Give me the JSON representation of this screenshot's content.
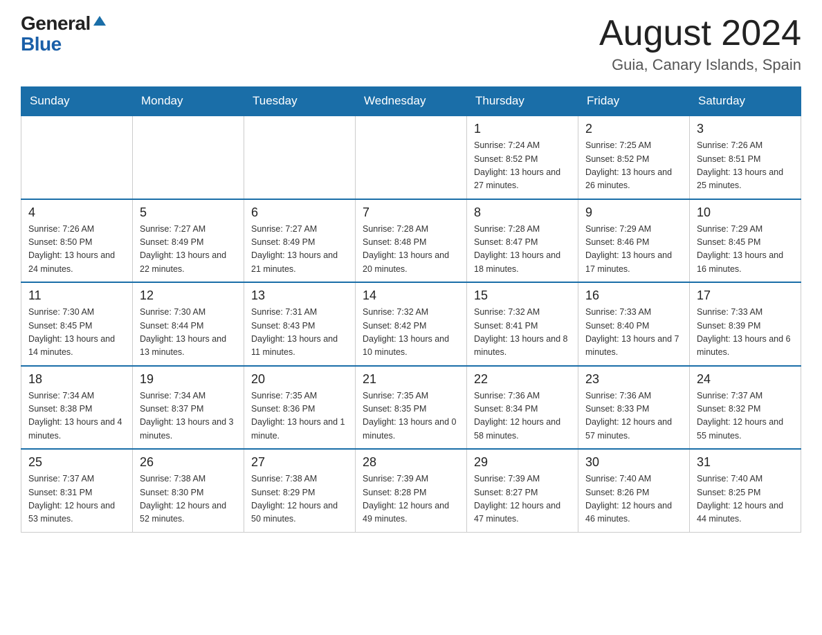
{
  "logo": {
    "general": "General",
    "blue": "Blue"
  },
  "header": {
    "month_year": "August 2024",
    "location": "Guia, Canary Islands, Spain"
  },
  "days_of_week": [
    "Sunday",
    "Monday",
    "Tuesday",
    "Wednesday",
    "Thursday",
    "Friday",
    "Saturday"
  ],
  "weeks": [
    [
      {
        "day": "",
        "info": ""
      },
      {
        "day": "",
        "info": ""
      },
      {
        "day": "",
        "info": ""
      },
      {
        "day": "",
        "info": ""
      },
      {
        "day": "1",
        "info": "Sunrise: 7:24 AM\nSunset: 8:52 PM\nDaylight: 13 hours and 27 minutes."
      },
      {
        "day": "2",
        "info": "Sunrise: 7:25 AM\nSunset: 8:52 PM\nDaylight: 13 hours and 26 minutes."
      },
      {
        "day": "3",
        "info": "Sunrise: 7:26 AM\nSunset: 8:51 PM\nDaylight: 13 hours and 25 minutes."
      }
    ],
    [
      {
        "day": "4",
        "info": "Sunrise: 7:26 AM\nSunset: 8:50 PM\nDaylight: 13 hours and 24 minutes."
      },
      {
        "day": "5",
        "info": "Sunrise: 7:27 AM\nSunset: 8:49 PM\nDaylight: 13 hours and 22 minutes."
      },
      {
        "day": "6",
        "info": "Sunrise: 7:27 AM\nSunset: 8:49 PM\nDaylight: 13 hours and 21 minutes."
      },
      {
        "day": "7",
        "info": "Sunrise: 7:28 AM\nSunset: 8:48 PM\nDaylight: 13 hours and 20 minutes."
      },
      {
        "day": "8",
        "info": "Sunrise: 7:28 AM\nSunset: 8:47 PM\nDaylight: 13 hours and 18 minutes."
      },
      {
        "day": "9",
        "info": "Sunrise: 7:29 AM\nSunset: 8:46 PM\nDaylight: 13 hours and 17 minutes."
      },
      {
        "day": "10",
        "info": "Sunrise: 7:29 AM\nSunset: 8:45 PM\nDaylight: 13 hours and 16 minutes."
      }
    ],
    [
      {
        "day": "11",
        "info": "Sunrise: 7:30 AM\nSunset: 8:45 PM\nDaylight: 13 hours and 14 minutes."
      },
      {
        "day": "12",
        "info": "Sunrise: 7:30 AM\nSunset: 8:44 PM\nDaylight: 13 hours and 13 minutes."
      },
      {
        "day": "13",
        "info": "Sunrise: 7:31 AM\nSunset: 8:43 PM\nDaylight: 13 hours and 11 minutes."
      },
      {
        "day": "14",
        "info": "Sunrise: 7:32 AM\nSunset: 8:42 PM\nDaylight: 13 hours and 10 minutes."
      },
      {
        "day": "15",
        "info": "Sunrise: 7:32 AM\nSunset: 8:41 PM\nDaylight: 13 hours and 8 minutes."
      },
      {
        "day": "16",
        "info": "Sunrise: 7:33 AM\nSunset: 8:40 PM\nDaylight: 13 hours and 7 minutes."
      },
      {
        "day": "17",
        "info": "Sunrise: 7:33 AM\nSunset: 8:39 PM\nDaylight: 13 hours and 6 minutes."
      }
    ],
    [
      {
        "day": "18",
        "info": "Sunrise: 7:34 AM\nSunset: 8:38 PM\nDaylight: 13 hours and 4 minutes."
      },
      {
        "day": "19",
        "info": "Sunrise: 7:34 AM\nSunset: 8:37 PM\nDaylight: 13 hours and 3 minutes."
      },
      {
        "day": "20",
        "info": "Sunrise: 7:35 AM\nSunset: 8:36 PM\nDaylight: 13 hours and 1 minute."
      },
      {
        "day": "21",
        "info": "Sunrise: 7:35 AM\nSunset: 8:35 PM\nDaylight: 13 hours and 0 minutes."
      },
      {
        "day": "22",
        "info": "Sunrise: 7:36 AM\nSunset: 8:34 PM\nDaylight: 12 hours and 58 minutes."
      },
      {
        "day": "23",
        "info": "Sunrise: 7:36 AM\nSunset: 8:33 PM\nDaylight: 12 hours and 57 minutes."
      },
      {
        "day": "24",
        "info": "Sunrise: 7:37 AM\nSunset: 8:32 PM\nDaylight: 12 hours and 55 minutes."
      }
    ],
    [
      {
        "day": "25",
        "info": "Sunrise: 7:37 AM\nSunset: 8:31 PM\nDaylight: 12 hours and 53 minutes."
      },
      {
        "day": "26",
        "info": "Sunrise: 7:38 AM\nSunset: 8:30 PM\nDaylight: 12 hours and 52 minutes."
      },
      {
        "day": "27",
        "info": "Sunrise: 7:38 AM\nSunset: 8:29 PM\nDaylight: 12 hours and 50 minutes."
      },
      {
        "day": "28",
        "info": "Sunrise: 7:39 AM\nSunset: 8:28 PM\nDaylight: 12 hours and 49 minutes."
      },
      {
        "day": "29",
        "info": "Sunrise: 7:39 AM\nSunset: 8:27 PM\nDaylight: 12 hours and 47 minutes."
      },
      {
        "day": "30",
        "info": "Sunrise: 7:40 AM\nSunset: 8:26 PM\nDaylight: 12 hours and 46 minutes."
      },
      {
        "day": "31",
        "info": "Sunrise: 7:40 AM\nSunset: 8:25 PM\nDaylight: 12 hours and 44 minutes."
      }
    ]
  ]
}
